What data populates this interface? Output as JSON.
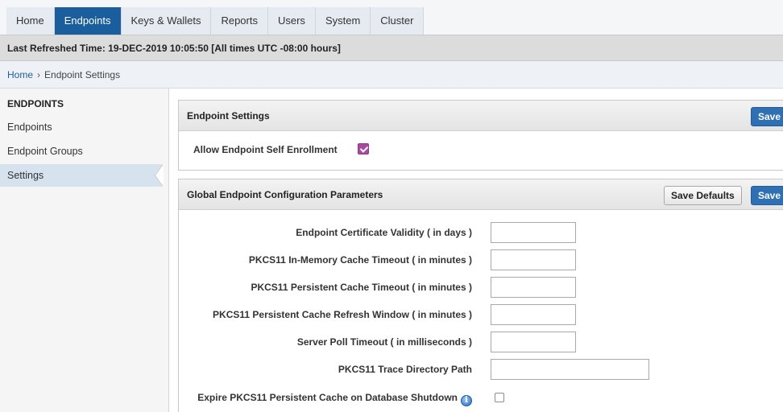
{
  "nav": {
    "tabs": [
      {
        "label": "Home",
        "active": false
      },
      {
        "label": "Endpoints",
        "active": true
      },
      {
        "label": "Keys & Wallets",
        "active": false
      },
      {
        "label": "Reports",
        "active": false
      },
      {
        "label": "Users",
        "active": false
      },
      {
        "label": "System",
        "active": false
      },
      {
        "label": "Cluster",
        "active": false
      }
    ]
  },
  "refresh": {
    "text": "Last Refreshed Time: 19-DEC-2019 10:05:50 [All times UTC -08:00 hours]"
  },
  "breadcrumb": {
    "home": "Home",
    "separator": "›",
    "current": "Endpoint Settings"
  },
  "sidebar": {
    "heading": "ENDPOINTS",
    "items": [
      {
        "label": "Endpoints",
        "active": false
      },
      {
        "label": "Endpoint Groups",
        "active": false
      },
      {
        "label": "Settings",
        "active": true
      }
    ]
  },
  "endpoint_settings": {
    "title": "Endpoint Settings",
    "save_label": "Save",
    "self_enroll_label": "Allow Endpoint Self Enrollment",
    "self_enroll_checked": true
  },
  "global_config": {
    "title": "Global Endpoint Configuration Parameters",
    "save_defaults_label": "Save Defaults",
    "save_label": "Save",
    "fields": [
      {
        "label": "Endpoint Certificate Validity ( in days )",
        "value": ""
      },
      {
        "label": "PKCS11 In-Memory Cache Timeout ( in minutes )",
        "value": ""
      },
      {
        "label": "PKCS11 Persistent Cache Timeout ( in minutes )",
        "value": ""
      },
      {
        "label": "PKCS11 Persistent Cache Refresh Window ( in minutes )",
        "value": ""
      },
      {
        "label": "Server Poll Timeout ( in milliseconds )",
        "value": ""
      },
      {
        "label": "PKCS11 Trace Directory Path",
        "value": ""
      }
    ],
    "expire_label": "Expire PKCS11 Persistent Cache on Database Shutdown",
    "expire_info_glyph": "i",
    "expire_checked": false
  },
  "colors": {
    "active_tab": "#1b5e9e",
    "primary_button": "#2f6fb3",
    "checkbox_accent": "#a94aa1",
    "link": "#1f5f9f"
  },
  "icons": {
    "info": "info-icon",
    "breadcrumb_separator": "chevron-right-icon"
  }
}
